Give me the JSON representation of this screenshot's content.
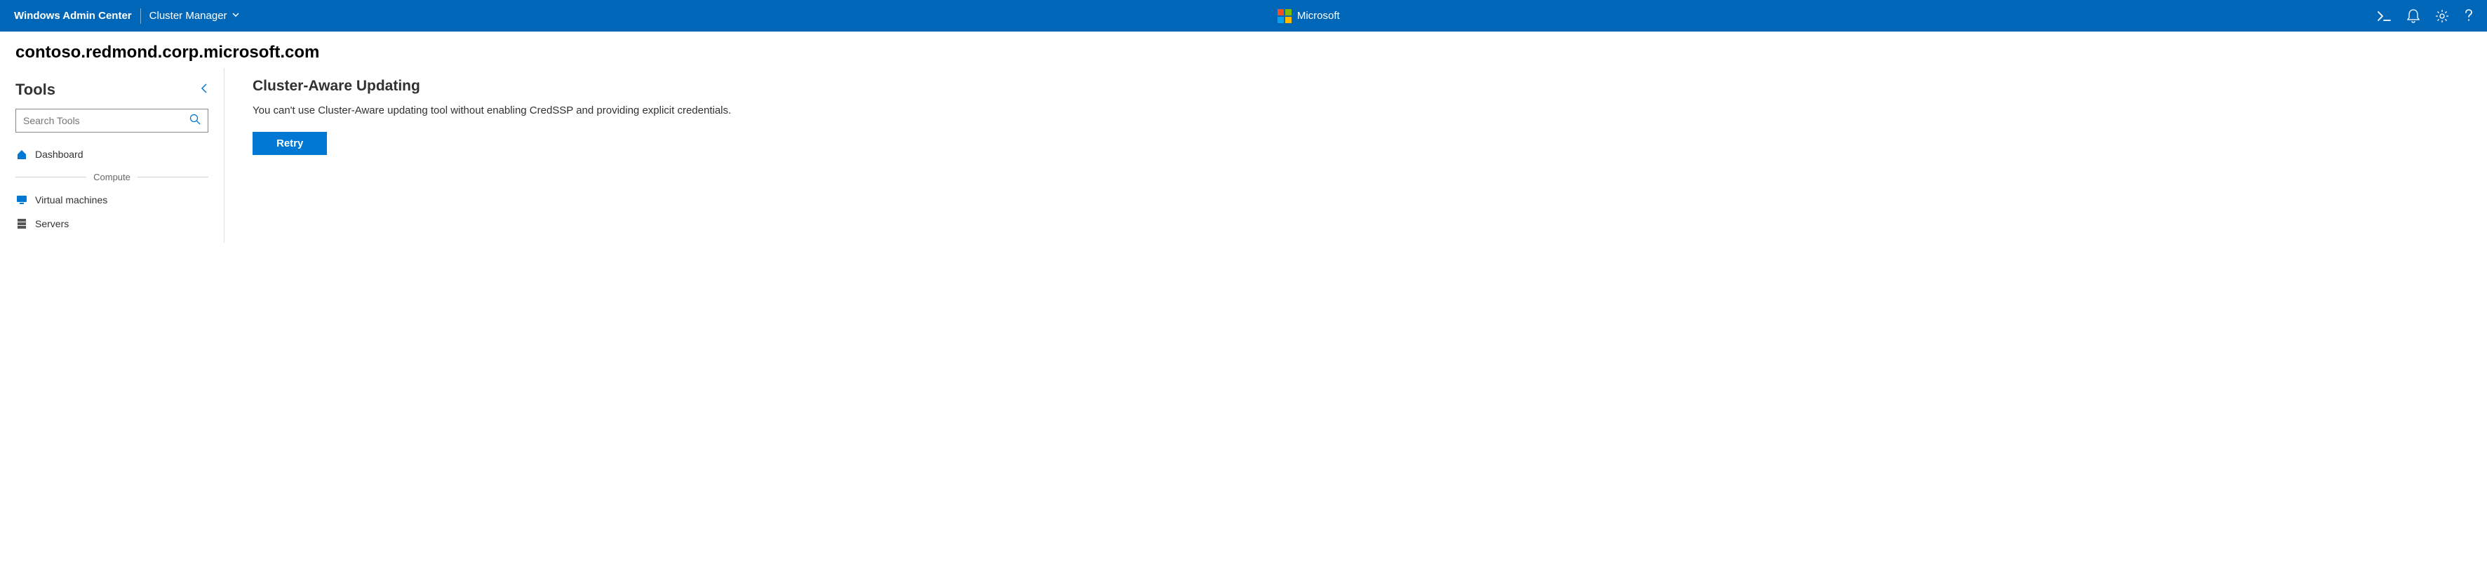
{
  "topbar": {
    "product": "Windows Admin Center",
    "context": "Cluster Manager",
    "brand": "Microsoft"
  },
  "breadcrumb": {
    "host": "contoso.redmond.corp.microsoft.com"
  },
  "sidebar": {
    "title": "Tools",
    "search_placeholder": "Search Tools",
    "items": {
      "dashboard": "Dashboard",
      "vms": "Virtual machines",
      "servers": "Servers"
    },
    "sections": {
      "compute": "Compute"
    }
  },
  "main": {
    "title": "Cluster-Aware Updating",
    "message": "You can't use Cluster-Aware updating tool without enabling CredSSP and providing explicit credentials.",
    "retry": "Retry"
  }
}
